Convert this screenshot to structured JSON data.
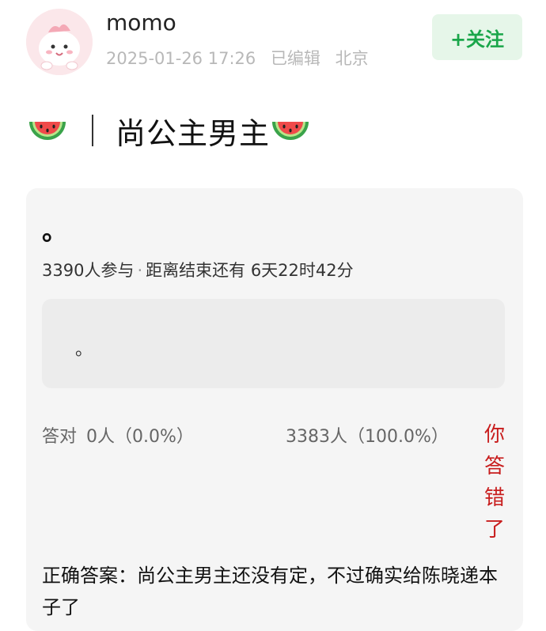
{
  "post": {
    "author": "momo",
    "date": "2025-01-26 17:26",
    "edited": "已编辑",
    "location": "北京",
    "follow_label": "+关注",
    "title_sep": "|",
    "title": "尚公主男主"
  },
  "poll": {
    "question": "。",
    "participants": "3390人参与",
    "separator": "·",
    "countdown": "距离结束还有 6天22时42分",
    "option": "。",
    "correct_label": "答对",
    "correct_value": "0人（0.0%）",
    "wrong_value": "3383人（100.0%）",
    "you_wrong": [
      "你",
      "答",
      "错",
      "了"
    ],
    "answer_text": "正确答案：尚公主男主还没有定，不过确实给陈晓递本子了"
  },
  "icons": {
    "avatar": "pink-dinosaur-avatar",
    "title_left": "watermelon-icon",
    "title_right": "watermelon-icon"
  },
  "colors": {
    "follow_text": "#1aa64a",
    "follow_bg": "#e6f6e9",
    "wrong_text": "#c81d1d",
    "card_bg": "#f5f5f5"
  }
}
